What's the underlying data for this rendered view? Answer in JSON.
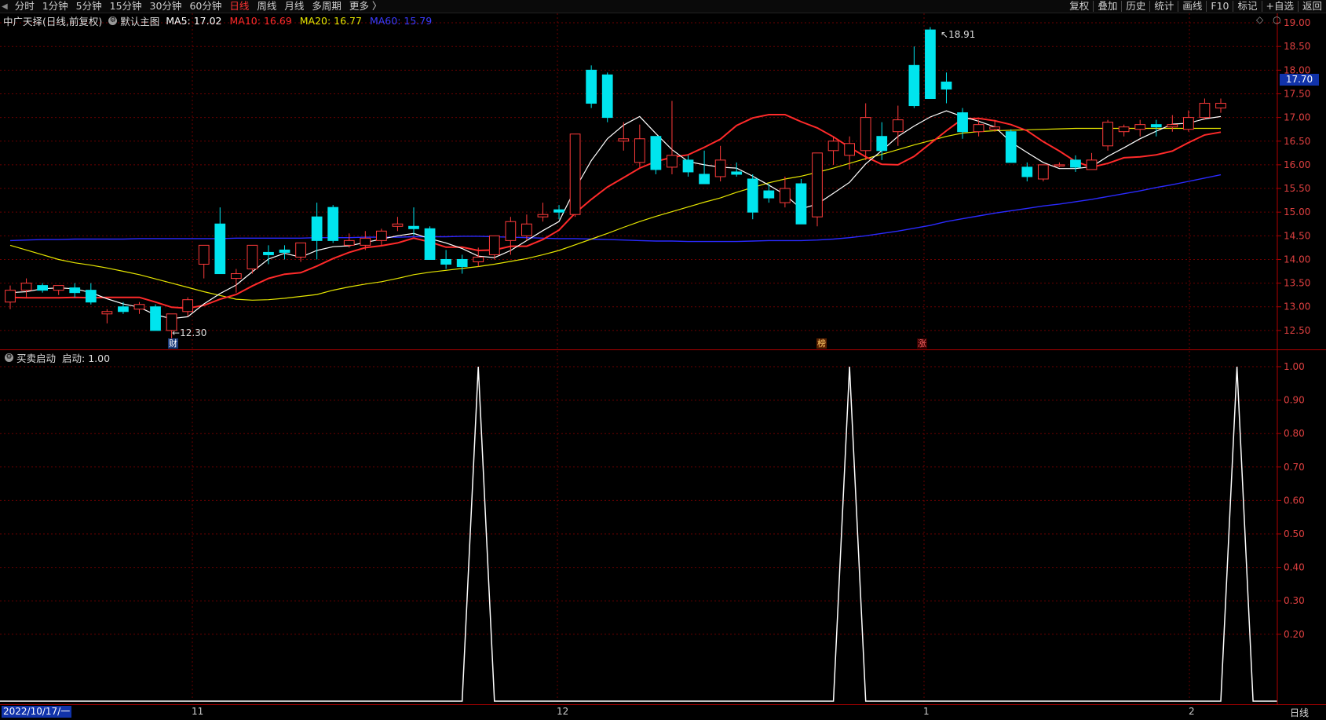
{
  "toolbar": {
    "periods": [
      "分时",
      "1分钟",
      "5分钟",
      "15分钟",
      "30分钟",
      "60分钟",
      "日线",
      "周线",
      "月线",
      "多周期",
      "更多 〉"
    ],
    "active_period": "日线",
    "right_items": [
      "复权",
      "叠加",
      "历史",
      "统计",
      "画线",
      "F10",
      "标记",
      "+自选",
      "返回"
    ]
  },
  "main_panel": {
    "stock": "中广天择(日线,前复权)",
    "indicator_name": "默认主图",
    "ma5_label": "MA5: 17.02",
    "ma10_label": "MA10: 16.69",
    "ma20_label": "MA20: 16.77",
    "ma60_label": "MA60: 15.79",
    "colors": {
      "ma5": "#ffffff",
      "ma10": "#ff2a2a",
      "ma20": "#e6e600",
      "ma60": "#2a2aff",
      "up": "#ff3b3b",
      "down": "#00e5ee",
      "grid": "#6a0000",
      "axis": "#b00000"
    },
    "high_label": "18.91",
    "low_label": "12.30",
    "current_price": "17.70",
    "y_ticks": [
      "19.00",
      "18.50",
      "18.00",
      "17.50",
      "17.00",
      "16.50",
      "16.00",
      "15.50",
      "15.00",
      "14.50",
      "14.00",
      "13.50",
      "13.00",
      "12.50"
    ],
    "event_tags": [
      "财",
      "榜",
      "涨"
    ]
  },
  "sub_panel": {
    "name": "买卖启动",
    "value_label": "启动: 1.00",
    "y_ticks": [
      "1.00",
      "0.90",
      "0.80",
      "0.70",
      "0.60",
      "0.50",
      "0.40",
      "0.30",
      "0.20"
    ]
  },
  "x_axis": {
    "start_date": "2022/10/17/一",
    "months": [
      "11",
      "12",
      "1",
      "2"
    ],
    "period_label": "日线"
  },
  "chart_data": {
    "type": "candlestick",
    "ylim": [
      12.1,
      19.2
    ],
    "candles": [
      [
        13.1,
        13.45,
        12.95,
        13.35
      ],
      [
        13.35,
        13.6,
        13.2,
        13.5
      ],
      [
        13.45,
        13.5,
        13.3,
        13.35
      ],
      [
        13.35,
        13.45,
        13.25,
        13.45
      ],
      [
        13.4,
        13.5,
        13.2,
        13.3
      ],
      [
        13.35,
        13.5,
        13.05,
        13.1
      ],
      [
        12.85,
        12.95,
        12.65,
        12.9
      ],
      [
        13.0,
        13.1,
        12.85,
        12.9
      ],
      [
        12.95,
        13.1,
        12.85,
        13.05
      ],
      [
        13.0,
        13.05,
        12.5,
        12.5
      ],
      [
        12.5,
        12.8,
        12.3,
        12.85
      ],
      [
        12.9,
        13.2,
        12.8,
        13.15
      ],
      [
        13.9,
        14.1,
        13.6,
        14.3
      ],
      [
        14.75,
        15.1,
        13.7,
        13.7
      ],
      [
        13.6,
        13.8,
        13.3,
        13.7
      ],
      [
        13.8,
        14.25,
        13.7,
        14.3
      ],
      [
        14.15,
        14.3,
        13.9,
        14.1
      ],
      [
        14.2,
        14.3,
        14.0,
        14.15
      ],
      [
        14.05,
        14.25,
        13.95,
        14.35
      ],
      [
        14.9,
        15.2,
        14.0,
        14.4
      ],
      [
        15.1,
        15.15,
        14.35,
        14.4
      ],
      [
        14.3,
        14.55,
        14.25,
        14.4
      ],
      [
        14.3,
        14.6,
        14.2,
        14.45
      ],
      [
        14.4,
        14.65,
        14.3,
        14.6
      ],
      [
        14.7,
        14.9,
        14.6,
        14.75
      ],
      [
        14.7,
        15.1,
        14.5,
        14.65
      ],
      [
        14.65,
        14.7,
        14.0,
        14.0
      ],
      [
        14.0,
        14.2,
        13.8,
        13.9
      ],
      [
        14.0,
        14.1,
        13.7,
        13.85
      ],
      [
        13.95,
        14.25,
        13.85,
        14.05
      ],
      [
        14.1,
        14.45,
        14.0,
        14.5
      ],
      [
        14.4,
        14.9,
        14.1,
        14.8
      ],
      [
        14.5,
        14.95,
        14.4,
        14.75
      ],
      [
        14.9,
        15.2,
        14.8,
        14.95
      ],
      [
        15.05,
        15.15,
        14.85,
        15.0
      ],
      [
        14.95,
        16.6,
        14.9,
        16.65
      ],
      [
        18.0,
        18.1,
        17.2,
        17.3
      ],
      [
        17.9,
        17.95,
        16.9,
        17.0
      ],
      [
        16.5,
        16.9,
        16.3,
        16.55
      ],
      [
        16.05,
        16.85,
        15.95,
        16.55
      ],
      [
        16.6,
        16.6,
        15.8,
        15.9
      ],
      [
        15.95,
        17.35,
        15.8,
        16.2
      ],
      [
        16.1,
        16.2,
        15.75,
        15.85
      ],
      [
        15.8,
        16.3,
        15.7,
        15.6
      ],
      [
        15.75,
        16.4,
        15.65,
        16.1
      ],
      [
        15.85,
        16.05,
        15.75,
        15.8
      ],
      [
        15.7,
        15.8,
        14.85,
        15.0
      ],
      [
        15.45,
        15.6,
        15.2,
        15.3
      ],
      [
        15.2,
        15.75,
        15.1,
        15.5
      ],
      [
        15.6,
        15.7,
        14.75,
        14.75
      ],
      [
        14.9,
        16.2,
        14.7,
        16.25
      ],
      [
        16.3,
        16.6,
        16.0,
        16.5
      ],
      [
        16.2,
        16.6,
        15.9,
        16.45
      ],
      [
        16.3,
        17.3,
        16.1,
        17.0
      ],
      [
        16.6,
        16.9,
        16.1,
        16.3
      ],
      [
        16.7,
        17.25,
        16.4,
        16.95
      ],
      [
        18.1,
        18.5,
        17.2,
        17.25
      ],
      [
        18.85,
        18.91,
        17.4,
        17.4
      ],
      [
        17.75,
        17.95,
        17.3,
        17.6
      ],
      [
        17.1,
        17.2,
        16.55,
        16.7
      ],
      [
        16.7,
        16.95,
        16.6,
        16.85
      ],
      [
        16.75,
        16.95,
        16.7,
        16.8
      ],
      [
        16.7,
        16.75,
        16.05,
        16.05
      ],
      [
        15.95,
        16.05,
        15.65,
        15.75
      ],
      [
        15.7,
        16.0,
        15.65,
        16.0
      ],
      [
        16.0,
        16.05,
        15.95,
        16.0
      ],
      [
        16.1,
        16.2,
        15.85,
        15.95
      ],
      [
        15.9,
        16.25,
        15.9,
        16.1
      ],
      [
        16.4,
        16.95,
        16.3,
        16.9
      ],
      [
        16.7,
        16.85,
        16.6,
        16.8
      ],
      [
        16.75,
        16.95,
        16.6,
        16.85
      ],
      [
        16.85,
        16.95,
        16.6,
        16.8
      ],
      [
        16.8,
        17.05,
        16.7,
        16.85
      ],
      [
        16.75,
        17.15,
        16.7,
        17.0
      ],
      [
        17.0,
        17.4,
        16.95,
        17.3
      ],
      [
        17.2,
        17.4,
        17.1,
        17.3
      ]
    ],
    "ma5": [
      13.3,
      13.32,
      13.38,
      13.4,
      13.38,
      13.3,
      13.17,
      13.06,
      12.99,
      12.83,
      12.75,
      12.79,
      13.06,
      13.28,
      13.46,
      13.74,
      14.01,
      14.13,
      14.05,
      14.19,
      14.27,
      14.29,
      14.36,
      14.43,
      14.5,
      14.55,
      14.44,
      14.35,
      14.23,
      14.07,
      14.04,
      14.19,
      14.4,
      14.61,
      14.8,
      15.49,
      16.09,
      16.55,
      16.84,
      17.02,
      16.66,
      16.32,
      16.07,
      16.0,
      15.95,
      15.93,
      15.76,
      15.57,
      15.37,
      15.07,
      15.17,
      15.4,
      15.63,
      16.02,
      16.3,
      16.6,
      16.82,
      17.01,
      17.14,
      17.02,
      16.92,
      16.8,
      16.48,
      16.26,
      16.05,
      15.92,
      15.92,
      15.96,
      16.18,
      16.36,
      16.55,
      16.71,
      16.86,
      16.88,
      16.97,
      17.02
    ],
    "ma10": [
      13.2,
      13.19,
      13.19,
      13.19,
      13.2,
      13.19,
      13.2,
      13.2,
      13.2,
      13.1,
      12.99,
      12.97,
      13.03,
      13.16,
      13.26,
      13.44,
      13.6,
      13.69,
      13.72,
      13.86,
      14.02,
      14.15,
      14.25,
      14.29,
      14.35,
      14.45,
      14.37,
      14.26,
      14.26,
      14.19,
      14.2,
      14.28,
      14.28,
      14.42,
      14.62,
      14.98,
      15.27,
      15.53,
      15.73,
      15.93,
      16.07,
      16.16,
      16.21,
      16.37,
      16.54,
      16.83,
      16.99,
      17.06,
      17.06,
      16.91,
      16.78,
      16.59,
      16.37,
      16.17,
      16.01,
      16.0,
      16.18,
      16.45,
      16.72,
      16.97,
      16.98,
      16.93,
      16.85,
      16.72,
      16.49,
      16.29,
      16.07,
      15.95,
      16.03,
      16.15,
      16.17,
      16.21,
      16.29,
      16.47,
      16.63,
      16.69
    ],
    "ma20": [
      14.3,
      14.2,
      14.1,
      14.0,
      13.93,
      13.88,
      13.82,
      13.75,
      13.68,
      13.59,
      13.5,
      13.41,
      13.32,
      13.24,
      13.16,
      13.14,
      13.15,
      13.18,
      13.22,
      13.26,
      13.35,
      13.42,
      13.48,
      13.53,
      13.6,
      13.68,
      13.73,
      13.77,
      13.81,
      13.85,
      13.9,
      13.96,
      14.02,
      14.1,
      14.19,
      14.31,
      14.43,
      14.55,
      14.68,
      14.8,
      14.91,
      15.01,
      15.11,
      15.21,
      15.3,
      15.42,
      15.52,
      15.62,
      15.7,
      15.76,
      15.84,
      15.93,
      16.03,
      16.13,
      16.22,
      16.32,
      16.42,
      16.51,
      16.6,
      16.67,
      16.7,
      16.72,
      16.73,
      16.74,
      16.75,
      16.76,
      16.77,
      16.77,
      16.77,
      16.77,
      16.77,
      16.77,
      16.77,
      16.77,
      16.77,
      16.77
    ],
    "ma60": [
      14.4,
      14.41,
      14.42,
      14.42,
      14.43,
      14.43,
      14.43,
      14.43,
      14.44,
      14.44,
      14.44,
      14.44,
      14.44,
      14.44,
      14.45,
      14.45,
      14.45,
      14.45,
      14.45,
      14.46,
      14.46,
      14.46,
      14.47,
      14.47,
      14.47,
      14.48,
      14.48,
      14.48,
      14.49,
      14.49,
      14.48,
      14.47,
      14.46,
      14.45,
      14.44,
      14.44,
      14.43,
      14.42,
      14.41,
      14.4,
      14.39,
      14.39,
      14.38,
      14.38,
      14.38,
      14.38,
      14.39,
      14.4,
      14.4,
      14.4,
      14.41,
      14.43,
      14.46,
      14.5,
      14.55,
      14.6,
      14.66,
      14.72,
      14.8,
      14.86,
      14.92,
      14.98,
      15.03,
      15.08,
      15.13,
      15.17,
      15.22,
      15.27,
      15.33,
      15.39,
      15.45,
      15.52,
      15.58,
      15.65,
      15.72,
      15.79
    ],
    "signal": {
      "spikes": [
        29,
        52,
        76
      ],
      "min": 0,
      "max": 1
    }
  }
}
